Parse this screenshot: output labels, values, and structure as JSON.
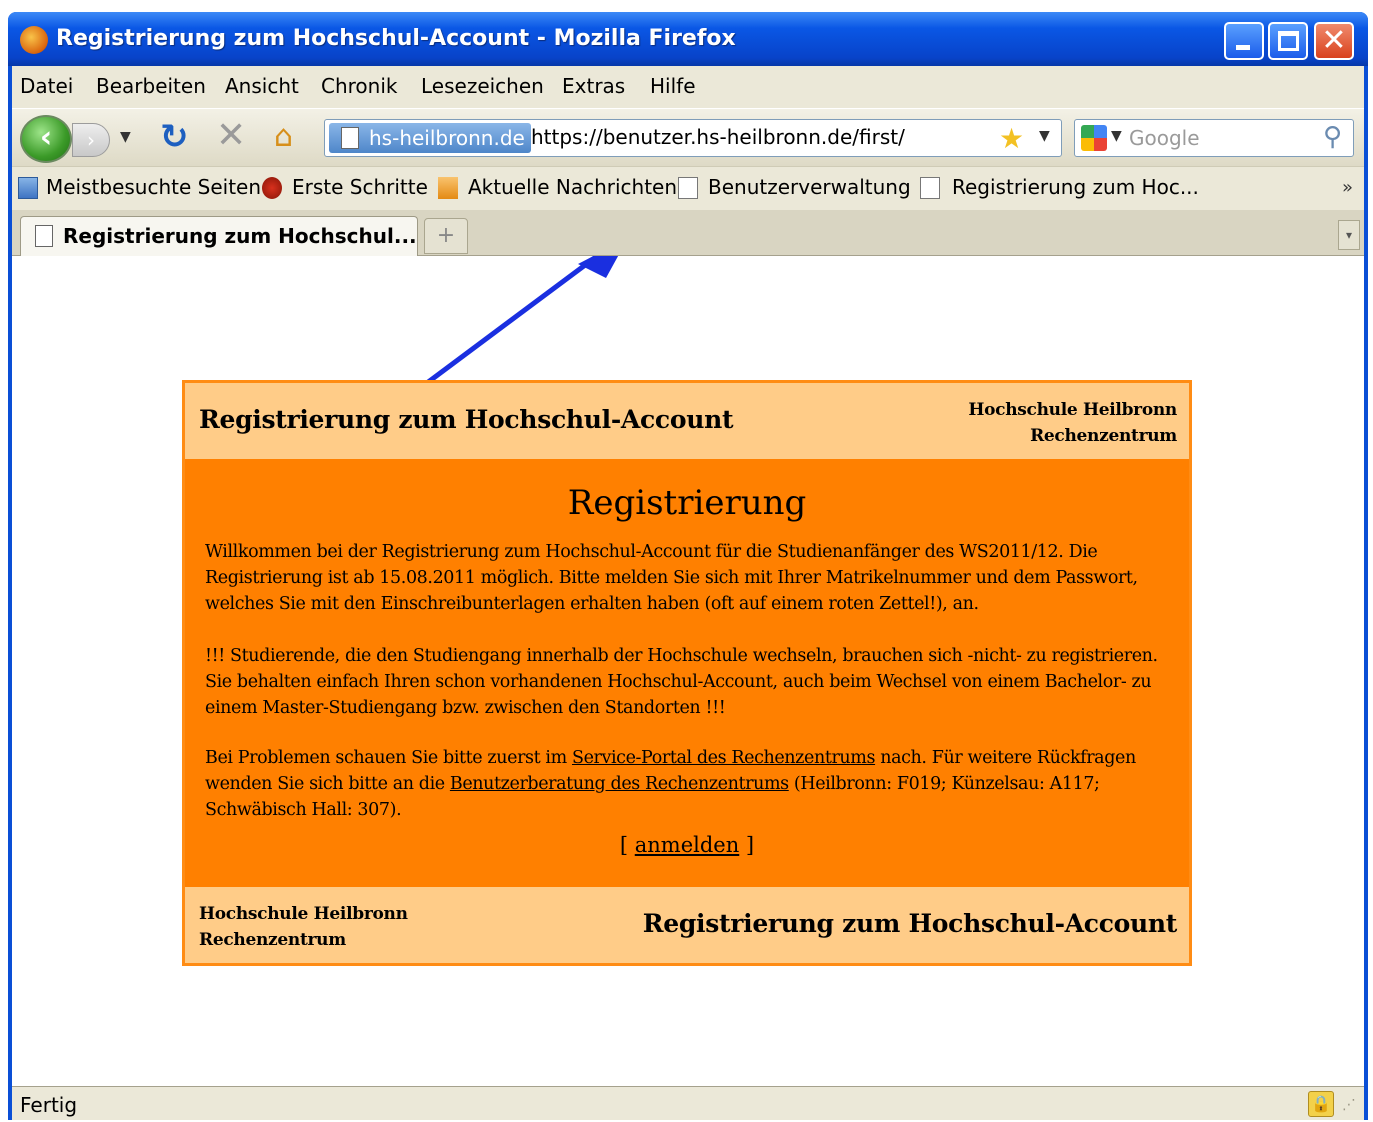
{
  "window": {
    "title": "Registrierung zum Hochschul-Account - Mozilla Firefox",
    "icon": "firefox-icon",
    "controls": {
      "minimize": "minimize-icon",
      "maximize": "maximize-icon",
      "close": "close-icon"
    }
  },
  "menubar": {
    "items": [
      "Datei",
      "Bearbeiten",
      "Ansicht",
      "Chronik",
      "Lesezeichen",
      "Extras",
      "Hilfe"
    ]
  },
  "navbar": {
    "back": "back-icon",
    "forward": "forward-icon",
    "reload": "reload-icon",
    "stop": "stop-icon",
    "home": "home-icon",
    "site_identity": "hs-heilbronn.de",
    "url": "https://benutzer.hs-heilbronn.de/first/",
    "search_placeholder": "Google"
  },
  "bookmarks": {
    "items": [
      "Meistbesuchte Seiten",
      "Erste Schritte",
      "Aktuelle Nachrichten",
      "Benutzerverwaltung",
      "Registrierung zum Hoc..."
    ],
    "overflow": "»"
  },
  "tabs": {
    "active_label": "Registrierung zum Hochschul...",
    "new_tab": "+"
  },
  "page": {
    "header_title": "Registrierung zum Hochschul-Account",
    "org_line1": "Hochschule Heilbronn",
    "org_line2": "Rechenzentrum",
    "heading": "Registrierung",
    "para1": "Willkommen bei der Registrierung zum Hochschul-Account für die Studienanfänger des WS2011/12. Die Registrierung ist ab 15.08.2011 möglich. Bitte melden Sie sich mit Ihrer Matrikelnummer und dem Passwort, welches Sie mit den Einschreibunterlagen erhalten haben (oft auf einem roten Zettel!), an.",
    "para2": "!!! Studierende, die den Studiengang innerhalb der Hochschule wechseln, brauchen sich -nicht- zu registrieren. Sie behalten einfach Ihren schon vorhandenen Hochschul-Account, auch beim Wechsel von einem Bachelor- zu einem Master-Studiengang bzw. zwischen den Standorten !!!",
    "para3_a": "Bei Problemen schauen Sie bitte zuerst im ",
    "para3_link1": "Service-Portal des Rechenzentrums",
    "para3_b": " nach. Für weitere Rückfragen wenden Sie sich bitte an die ",
    "para3_link2": "Benutzerberatung des Rechenzentrums",
    "para3_c": " (Heilbronn: F019; Künzelsau: A117; Schwäbisch Hall: 307).",
    "login_open": "[ ",
    "login_link": "anmelden",
    "login_close": " ]",
    "footer_title": "Registrierung zum Hochschul-Account"
  },
  "statusbar": {
    "text": "Fertig"
  },
  "colors": {
    "panel_light": "#ffcc88",
    "panel_orange": "#ff8000",
    "annotation_arrow": "#1a2fe0"
  }
}
